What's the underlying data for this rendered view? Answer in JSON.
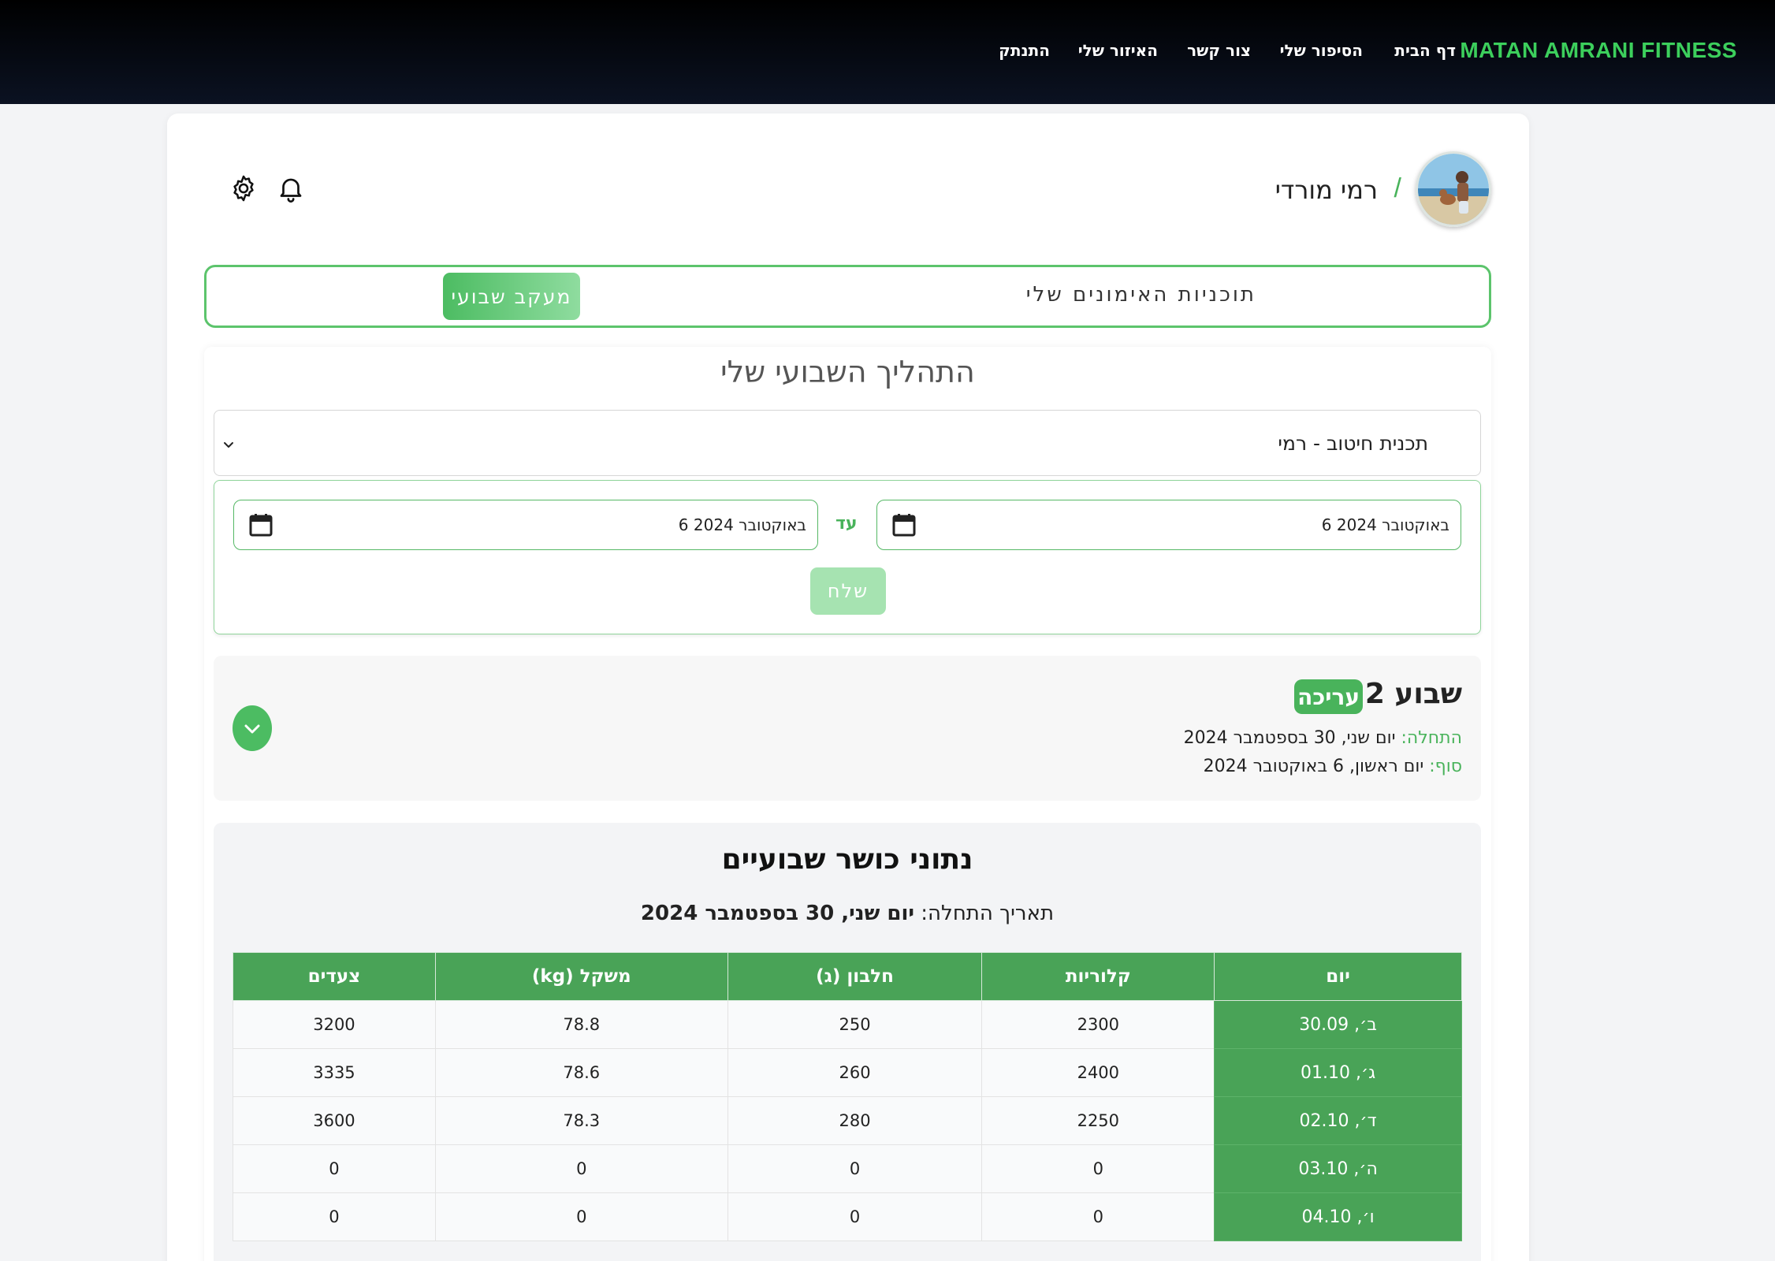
{
  "nav": {
    "brand": "MATAN AMRANI FITNESS",
    "links": [
      "דף הבית",
      "הסיפור שלי",
      "צור קשר",
      "האיזור שלי",
      "התנתק"
    ]
  },
  "profile": {
    "name": "רמי מורדי",
    "slash": "/"
  },
  "tabs": {
    "training_plans": "תוכניות האימונים שלי",
    "weekly_tracking": "מעקב שבועי"
  },
  "progress": {
    "title": "התהליך השבועי שלי",
    "plan_select": "תכנית חיטוב - רמי",
    "from_date": "6 באוקטובר 2024",
    "until_label": "עד",
    "to_date": "6 באוקטובר 2024",
    "send_label": "שלח"
  },
  "week": {
    "title": "שבוע 2",
    "edit_badge": "עריכה",
    "start_label": "התחלה:",
    "start_value": " יום שני, 30 בספטמבר 2024",
    "end_label": "סוף:",
    "end_value": " יום ראשון, 6 באוקטובר 2024"
  },
  "fitness": {
    "title": "נתוני כושר שבועיים",
    "start_label": "תאריך התחלה: ",
    "start_value": "יום שני, 30 בספטמבר 2024",
    "columns": [
      "יום",
      "קלוריות",
      "חלבון (ג)",
      "משקל (kg)",
      "צעדים"
    ],
    "rows": [
      [
        "ב׳, 30.09",
        "2300",
        "250",
        "78.8",
        "3200"
      ],
      [
        "ג׳, 01.10",
        "2400",
        "260",
        "78.6",
        "3335"
      ],
      [
        "ד׳, 02.10",
        "2250",
        "280",
        "78.3",
        "3600"
      ],
      [
        "ה׳, 03.10",
        "0",
        "0",
        "0",
        "0"
      ],
      [
        "ו׳, 04.10",
        "0",
        "0",
        "0",
        "0"
      ]
    ]
  },
  "colors": {
    "brand_green": "#3ccf5c",
    "accent_green": "#49b35b",
    "table_header": "#49a357",
    "nav_bg": "#000000"
  },
  "icons": [
    "gear-icon",
    "bell-icon",
    "calendar-icon",
    "chevron-down-icon"
  ]
}
